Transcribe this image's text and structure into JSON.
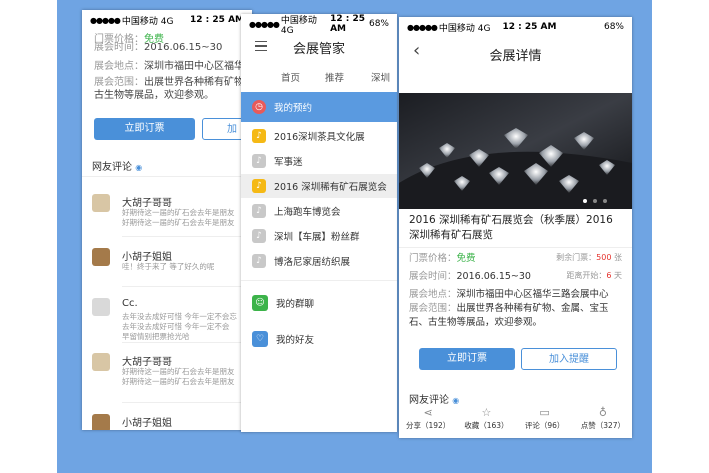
{
  "status": {
    "carrier": "中国移动 4G",
    "time": "12 : 25 AM",
    "battery": "68%",
    "battery_short": "68%"
  },
  "phone1": {
    "price_label": "门票价格：",
    "price_value": "免费",
    "time_label": "展会时间：",
    "time_value": "2016.06.15~30",
    "place_label": "展会地点：",
    "place_value": "深圳市福田中心区福华三",
    "range_label": "展会范围：",
    "range_value_1": "出展世界各种稀有矿物、",
    "range_value_2": "古生物等展品，欢迎参观。",
    "buy_label": "立即订票",
    "remind_label": "加",
    "comments_title": "网友评论",
    "comments": [
      {
        "name": "大胡子哥哥",
        "text": "好期待这一届的矿石会去年是朋友\n好期待这一届的矿石会去年是朋友"
      },
      {
        "name": "小胡子姐姐",
        "text": "哇！终于来了 等了好久的呢"
      },
      {
        "name": "Cc.",
        "text": "去年没去成好可惜 今年一定不会忘\n去年没去成好可惜 今年一定不会\n早留情别把票抢光哈"
      },
      {
        "name": "大胡子哥哥",
        "text": "好期待这一届的矿石会去年是朋友\n好期待这一届的矿石会去年是朋友\n好期待非常有趣 一直等着下次什么时候"
      },
      {
        "name": "小胡子姐姐",
        "text": ""
      }
    ]
  },
  "phone2": {
    "title": "会展管家",
    "tabs": [
      "首页",
      "推荐",
      "深圳"
    ],
    "my_booking": "我的预约",
    "items": [
      "2016深圳茶具文化展",
      "军事迷",
      "2016 深圳稀有矿石展览会",
      "上海跑车博览会",
      "深圳【车展】粉丝群",
      "博洛尼家居纺织展"
    ],
    "my_groups": "我的群聊",
    "my_friends": "我的好友"
  },
  "phone3": {
    "title": "会展详情",
    "event_title": "2016 深圳稀有矿石展览会（秋季展）2016 深圳稀有矿石展览",
    "price_label": "门票价格：",
    "price_value": "免费",
    "remaining_label": "剩余门票：",
    "remaining_value": "500",
    "remaining_unit": "张",
    "time_label": "展会时间：",
    "time_value": "2016.06.15~30",
    "countdown_label": "距离开始：",
    "countdown_value": "6",
    "countdown_unit": "天",
    "place_label": "展会地点：",
    "place_value": "深圳市福田中心区福华三路会展中心",
    "range_label": "展会范围：",
    "range_value": "出展世界各种稀有矿物、金属、宝玉石、古生物等展品，欢迎参观。",
    "buy_label": "立即订票",
    "remind_label": "加入提醒",
    "comments_title": "网友评论",
    "actions": [
      {
        "label": "分享（192）",
        "icon": "share-icon"
      },
      {
        "label": "收藏（163）",
        "icon": "star-icon"
      },
      {
        "label": "评论（96）",
        "icon": "comment-icon"
      },
      {
        "label": "点赞（327）",
        "icon": "thumbs-up-icon"
      }
    ]
  },
  "colors": {
    "accent": "#4a90d9",
    "background": "#6fa4e3",
    "green": "#3cb34a",
    "red": "#e5322d",
    "yellow": "#f5b915",
    "gray_icon": "#c8c8c8"
  }
}
